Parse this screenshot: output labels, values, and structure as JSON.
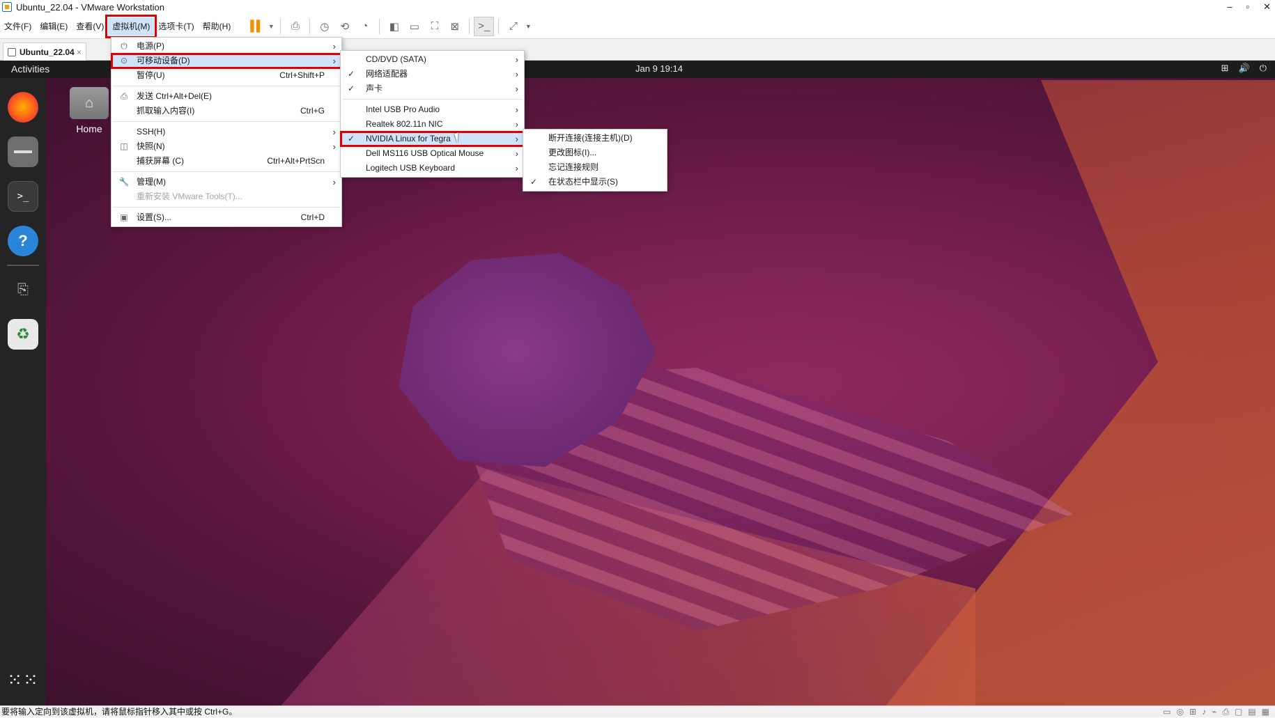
{
  "window": {
    "title": "Ubuntu_22.04 - VMware Workstation",
    "controls": [
      "–",
      "▫",
      "✕"
    ]
  },
  "menubar": {
    "items": [
      {
        "label": "文件(F)"
      },
      {
        "label": "编辑(E)"
      },
      {
        "label": "查看(V)"
      },
      {
        "label": "虚拟机(M)",
        "active": true
      },
      {
        "label": "选项卡(T)"
      },
      {
        "label": "帮助(H)"
      }
    ]
  },
  "toolbar": {
    "icons": [
      "pause-icon",
      "dropdown-caret-icon",
      "send-ctrl-alt-del-icon",
      "snapshot-icon",
      "revert-snapshot-icon",
      "snapshot-manager-icon",
      "library-icon",
      "thumbnail-bar-icon",
      "fullscreen-icon",
      "unity-icon",
      "console-view-icon",
      "stretch-icon",
      "dropdown-caret-icon"
    ]
  },
  "tab": {
    "label": "Ubuntu_22.04",
    "close": "×"
  },
  "ubuntu": {
    "activities": "Activities",
    "clock": "Jan 9  19:14",
    "tray": [
      "network-icon",
      "volume-icon",
      "power-icon"
    ],
    "home_label": "Home"
  },
  "vm_menu": {
    "items": [
      {
        "icon": "power-icon",
        "glyph": "⏻",
        "label": "电源(P)",
        "shortcut": "",
        "submenu": true
      },
      {
        "icon": "removable-devices-icon",
        "glyph": "⊙",
        "label": "可移动设备(D)",
        "shortcut": "",
        "submenu": true,
        "highlight": true
      },
      {
        "icon": "",
        "glyph": "",
        "label": "暂停(U)",
        "shortcut": "Ctrl+Shift+P",
        "submenu": false
      },
      {
        "sep": true
      },
      {
        "icon": "send-keys-icon",
        "glyph": "⎙",
        "label": "发送 Ctrl+Alt+Del(E)",
        "shortcut": "",
        "submenu": false
      },
      {
        "icon": "",
        "glyph": "",
        "label": "抓取输入内容(I)",
        "shortcut": "Ctrl+G",
        "submenu": false
      },
      {
        "sep": true
      },
      {
        "icon": "",
        "glyph": "",
        "label": "SSH(H)",
        "shortcut": "",
        "submenu": true
      },
      {
        "icon": "snapshot-icon",
        "glyph": "◫",
        "label": "快照(N)",
        "shortcut": "",
        "submenu": true
      },
      {
        "icon": "",
        "glyph": "",
        "label": "捕获屏幕 (C)",
        "shortcut": "Ctrl+Alt+PrtScn",
        "submenu": false
      },
      {
        "sep": true
      },
      {
        "icon": "wrench-icon",
        "glyph": "🔧",
        "label": "管理(M)",
        "shortcut": "",
        "submenu": true
      },
      {
        "icon": "",
        "glyph": "",
        "label": "重新安装 VMware Tools(T)...",
        "shortcut": "",
        "submenu": false,
        "disabled": true
      },
      {
        "sep": true
      },
      {
        "icon": "settings-icon",
        "glyph": "▣",
        "label": "设置(S)...",
        "shortcut": "Ctrl+D",
        "submenu": false
      }
    ]
  },
  "devices_menu": {
    "items": [
      {
        "label": "CD/DVD (SATA)",
        "checked": false
      },
      {
        "label": "网络适配器",
        "checked": true
      },
      {
        "label": "声卡",
        "checked": true
      },
      {
        "sep": true
      },
      {
        "label": "Intel USB Pro Audio",
        "checked": false
      },
      {
        "label": "Realtek 802.11n NIC",
        "checked": false
      },
      {
        "label": "NVIDIA Linux for Tegra",
        "checked": true,
        "highlight": true
      },
      {
        "label": "Dell MS116 USB Optical Mouse",
        "checked": false
      },
      {
        "label": "Logitech USB Keyboard",
        "checked": false
      }
    ]
  },
  "device_submenu": {
    "items": [
      {
        "label": "断开连接(连接主机)(D)",
        "checked": false
      },
      {
        "label": "更改图标(I)...",
        "checked": false
      },
      {
        "label": "忘记连接规则",
        "checked": false
      },
      {
        "label": "在状态栏中显示(S)",
        "checked": true
      }
    ]
  },
  "statusbar": {
    "text": "要将输入定向到该虚拟机，请将鼠标指针移入其中或按 Ctrl+G。",
    "icons": [
      "hdd-icon",
      "cd-icon",
      "network-icon",
      "sound-icon",
      "usb-icon",
      "printer-icon",
      "display-icon",
      "device-icon",
      "message-icon"
    ]
  }
}
